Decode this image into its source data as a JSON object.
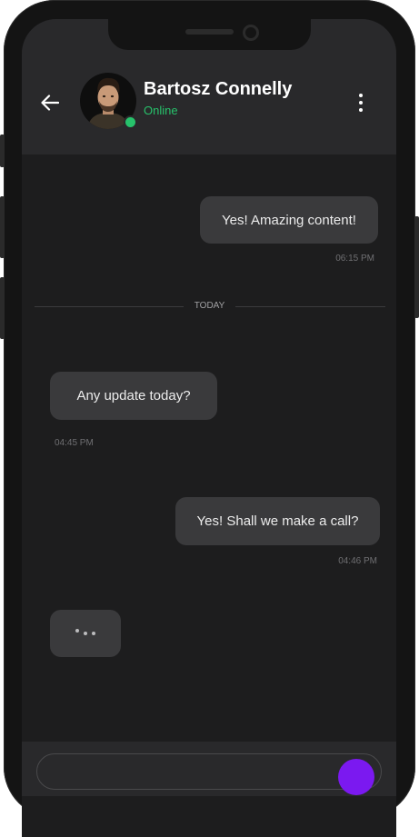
{
  "contact": {
    "name": "Bartosz Connelly",
    "status": "Online"
  },
  "messages": [
    {
      "text": "Yes! Amazing content!",
      "time": "06:15 PM",
      "direction": "outgoing"
    },
    {
      "text": "Any update today?",
      "time": "04:45 PM",
      "direction": "incoming"
    },
    {
      "text": "Yes! Shall we make a call?",
      "time": "04:46 PM",
      "direction": "outgoing"
    }
  ],
  "divider": {
    "label": "TODAY"
  },
  "icons": {
    "back": "arrow-left-icon",
    "menu": "more-vertical-icon",
    "typing": "typing-dots-icon",
    "send": "send-icon"
  },
  "colors": {
    "online": "#27c26b",
    "accent": "#7b19f0",
    "bubble": "#3a3a3c",
    "header": "#29292b",
    "background": "#1d1d1e"
  }
}
